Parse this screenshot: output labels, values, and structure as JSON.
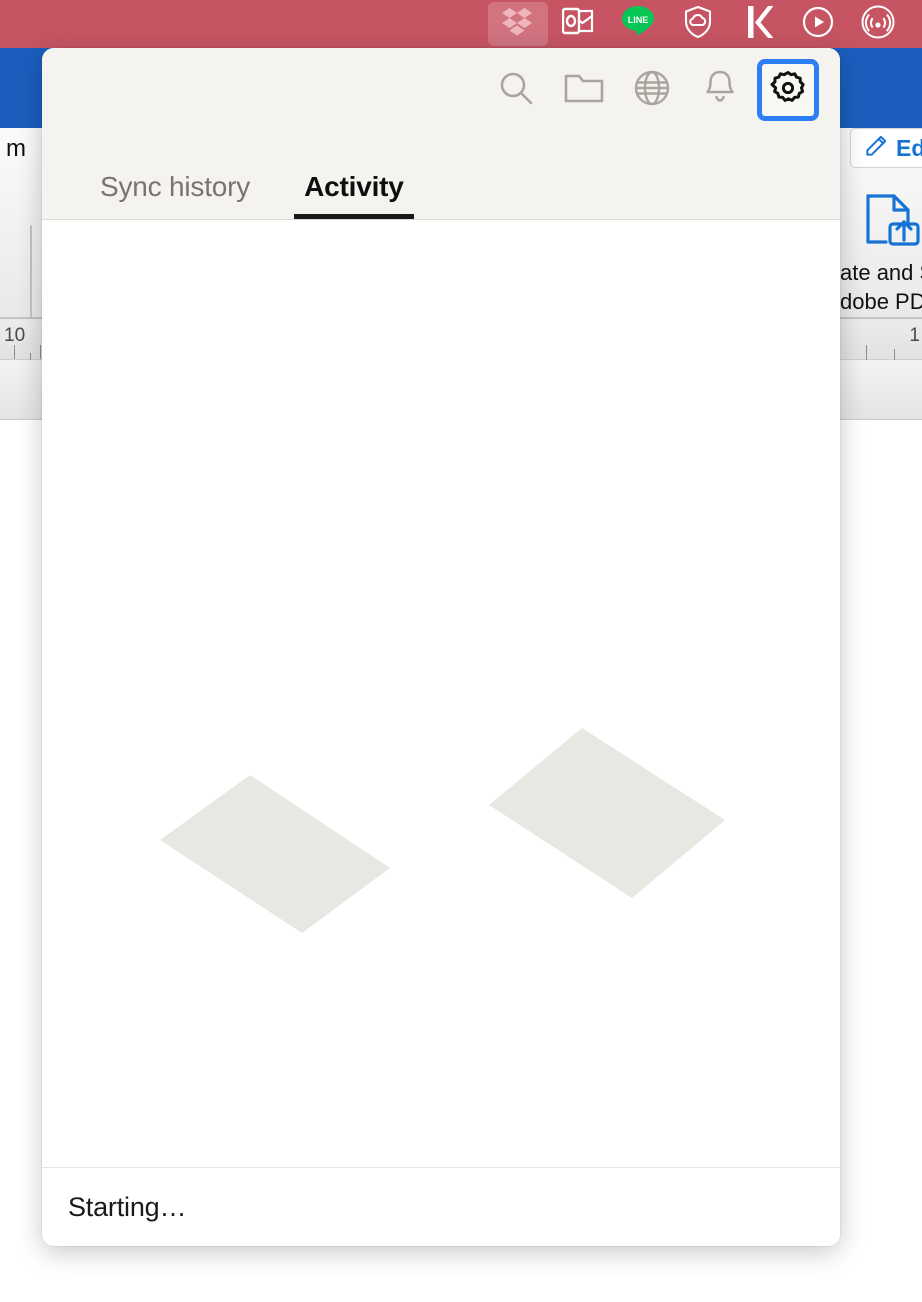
{
  "menubar": {
    "background_color": "#c75463",
    "items": [
      {
        "name": "dropbox-icon",
        "label": "Dropbox",
        "active": true
      },
      {
        "name": "outlook-icon",
        "label": "Microsoft Outlook",
        "active": false
      },
      {
        "name": "line-icon",
        "label": "LINE",
        "active": false
      },
      {
        "name": "security-shield-icon",
        "label": "Security Cloud",
        "active": false
      },
      {
        "name": "kindle-icon",
        "label": "k",
        "active": false
      },
      {
        "name": "play-circle-icon",
        "label": "Play",
        "active": false
      },
      {
        "name": "airplay-icon",
        "label": "AirPlay",
        "active": false
      }
    ]
  },
  "popup": {
    "toolbar": [
      {
        "name": "search-icon",
        "label": "Search",
        "focused": false
      },
      {
        "name": "folder-icon",
        "label": "Files",
        "focused": false
      },
      {
        "name": "globe-icon",
        "label": "Web",
        "focused": false
      },
      {
        "name": "bell-icon",
        "label": "Notifications",
        "focused": false
      },
      {
        "name": "gear-icon",
        "label": "Settings",
        "focused": true
      }
    ],
    "tabs": [
      {
        "label": "Sync history",
        "active": false
      },
      {
        "label": "Activity",
        "active": true
      }
    ],
    "empty_state": {
      "shape": "two-isometric-cards",
      "fill_color": "#e8e7e2"
    },
    "status": {
      "text": "Starting…"
    },
    "accent_color": "#2b7ef4",
    "header_color": "#f4f3ef"
  },
  "background_app": {
    "ribbon_color": "#1b5ebe",
    "document_text": "l m",
    "adobe_panel": {
      "edit_button_label": "Ed",
      "edit_icon": "pencil-icon",
      "pdf_icon": "document-upload-icon",
      "pdf_caption_line1": "ate and S",
      "pdf_caption_line2": "dobe PD"
    },
    "ruler": {
      "left_marker": "10",
      "right_marker": "1"
    }
  }
}
